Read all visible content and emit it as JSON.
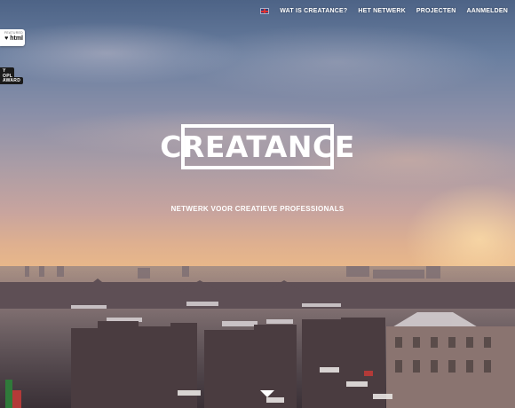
{
  "nav": {
    "language_icon": "uk-flag-icon",
    "items": [
      {
        "label": "WAT IS CREATANCE?"
      },
      {
        "label": "HET NETWERK"
      },
      {
        "label": "PROJECTEN"
      },
      {
        "label": "AANMELDEN"
      }
    ]
  },
  "badges": {
    "featured_small": "FEATURED",
    "featured_big": "♥ html",
    "award_1": "Y OPL",
    "award_2": "AWARD"
  },
  "hero": {
    "logo": "CREATANCE",
    "tagline": "NETWERK VOOR CREATIEVE PROFESSIONALS",
    "scroll_icon": "down-triangle-icon"
  },
  "colors": {
    "text": "#ffffff",
    "sky_top": "#4d6386",
    "sunset": "#e9b889"
  }
}
